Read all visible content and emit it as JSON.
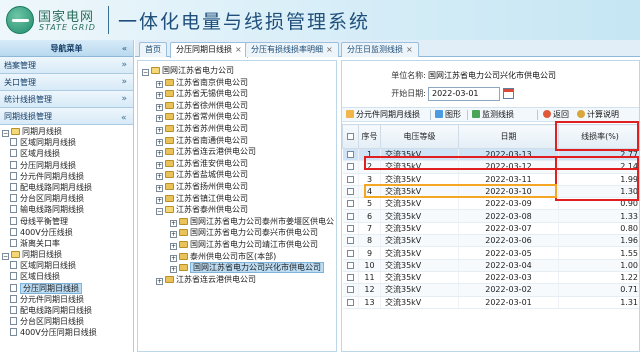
{
  "header": {
    "logo_cn": "国家电网",
    "logo_en": "STATE GRID",
    "app_title": "一体化电量与线损管理系统"
  },
  "sidebar": {
    "title": "导航菜单",
    "collapse_glyph": "«",
    "sections": [
      {
        "label": "档案管理",
        "chev": "»"
      },
      {
        "label": "关口管理",
        "chev": "»"
      },
      {
        "label": "统计线损管理",
        "chev": "»"
      },
      {
        "label": "同期线损管理",
        "chev": "»"
      }
    ],
    "tree": [
      {
        "label": "同期月线损",
        "type": "folder-open",
        "indent": 1
      },
      {
        "label": "区域同期月线损",
        "type": "file",
        "indent": 2
      },
      {
        "label": "区域月线损",
        "type": "file",
        "indent": 2
      },
      {
        "label": "分压同期月线损",
        "type": "file",
        "indent": 2
      },
      {
        "label": "分元件同期月线损",
        "type": "file",
        "indent": 2
      },
      {
        "label": "配电线路同期月线损",
        "type": "file",
        "indent": 2
      },
      {
        "label": "分台区同期月线损",
        "type": "file",
        "indent": 2
      },
      {
        "label": "输电线路同期线损",
        "type": "file",
        "indent": 2
      },
      {
        "label": "母线平衡管理",
        "type": "file",
        "indent": 2
      },
      {
        "label": "400V分压线损",
        "type": "file",
        "indent": 2
      },
      {
        "label": "渐离关口率",
        "type": "file",
        "indent": 2
      },
      {
        "label": "同期日线损",
        "type": "folder-open",
        "indent": 1
      },
      {
        "label": "区域同期日线损",
        "type": "file",
        "indent": 2
      },
      {
        "label": "区域日线损",
        "type": "file",
        "indent": 2
      },
      {
        "label": "分压同期日线损",
        "type": "file",
        "indent": 2,
        "selected": true
      },
      {
        "label": "分元件同期日线损",
        "type": "file",
        "indent": 2
      },
      {
        "label": "配电线路同期日线损",
        "type": "file",
        "indent": 2
      },
      {
        "label": "分台区同期日线损",
        "type": "file",
        "indent": 2
      },
      {
        "label": "400V分压同期日线损",
        "type": "file",
        "indent": 2
      }
    ]
  },
  "tabs": [
    {
      "label": "首页",
      "closable": false,
      "active": false
    },
    {
      "label": "分压同期日线损",
      "closable": true,
      "active": true
    },
    {
      "label": "分压有损线损率明细",
      "closable": true,
      "active": false
    },
    {
      "label": "分压日监测线损",
      "closable": true,
      "active": false
    }
  ],
  "org_tree": [
    {
      "label": "国网江苏省电力公司",
      "level": 0,
      "pm": "-",
      "open": true
    },
    {
      "label": "江苏省南京供电公司",
      "level": 1,
      "pm": "+"
    },
    {
      "label": "江苏省无锡供电公司",
      "level": 1,
      "pm": "+"
    },
    {
      "label": "江苏省徐州供电公司",
      "level": 1,
      "pm": "+"
    },
    {
      "label": "江苏省常州供电公司",
      "level": 1,
      "pm": "+"
    },
    {
      "label": "江苏省苏州供电公司",
      "level": 1,
      "pm": "+"
    },
    {
      "label": "江苏省南通供电公司",
      "level": 1,
      "pm": "+"
    },
    {
      "label": "江苏省连云港供电公司",
      "level": 1,
      "pm": "+"
    },
    {
      "label": "江苏省淮安供电公司",
      "level": 1,
      "pm": "+"
    },
    {
      "label": "江苏省盐城供电公司",
      "level": 1,
      "pm": "+"
    },
    {
      "label": "江苏省扬州供电公司",
      "level": 1,
      "pm": "+"
    },
    {
      "label": "江苏省镇江供电公司",
      "level": 1,
      "pm": "+"
    },
    {
      "label": "江苏省泰州供电公司",
      "level": 1,
      "pm": "-",
      "open": true
    },
    {
      "label": "国网江苏省电力公司泰州市姜堰区供电公",
      "level": 2,
      "pm": "+"
    },
    {
      "label": "国网江苏省电力公司泰兴市供电公司",
      "level": 2,
      "pm": "+"
    },
    {
      "label": "国网江苏省电力公司靖江市供电公司",
      "level": 2,
      "pm": "+"
    },
    {
      "label": "泰州供电公司市区(本部)",
      "level": 2,
      "pm": "+"
    },
    {
      "label": "国网江苏省电力公司兴化市供电公司",
      "level": 2,
      "pm": "+",
      "selected": true
    },
    {
      "label": "江苏省连云港供电公司",
      "level": 1,
      "pm": "+"
    }
  ],
  "form": {
    "org_label": "单位名称:",
    "org_value": "国网江苏省电力公司兴化市供电公司",
    "date_label": "开始日期:",
    "date_value": "2022-03-01"
  },
  "toolbar": {
    "btn1": "分元件同期月线损",
    "btn2": "图形",
    "btn3": "监测线损",
    "btn4": "返回",
    "btn5": "计算说明"
  },
  "table": {
    "headers": {
      "no": "序号",
      "level": "电压等级",
      "date": "日期",
      "rate": "线损率(%)"
    },
    "rows": [
      {
        "no": "1",
        "level": "交流35kV",
        "date": "2022-03-13",
        "rate": "2.77"
      },
      {
        "no": "2",
        "level": "交流35kV",
        "date": "2022-03-12",
        "rate": "2.14"
      },
      {
        "no": "3",
        "level": "交流35kV",
        "date": "2022-03-11",
        "rate": "1.99"
      },
      {
        "no": "4",
        "level": "交流35kV",
        "date": "2022-03-10",
        "rate": "1.30"
      },
      {
        "no": "5",
        "level": "交流35kV",
        "date": "2022-03-09",
        "rate": "0.90"
      },
      {
        "no": "6",
        "level": "交流35kV",
        "date": "2022-03-08",
        "rate": "1.33"
      },
      {
        "no": "7",
        "level": "交流35kV",
        "date": "2022-03-07",
        "rate": "0.80"
      },
      {
        "no": "8",
        "level": "交流35kV",
        "date": "2022-03-06",
        "rate": "1.96"
      },
      {
        "no": "9",
        "level": "交流35kV",
        "date": "2022-03-05",
        "rate": "1.55"
      },
      {
        "no": "10",
        "level": "交流35kV",
        "date": "2022-03-04",
        "rate": "1.00"
      },
      {
        "no": "11",
        "level": "交流35kV",
        "date": "2022-03-03",
        "rate": "1.22"
      },
      {
        "no": "12",
        "level": "交流35kV",
        "date": "2022-03-02",
        "rate": "0.71"
      },
      {
        "no": "13",
        "level": "交流35kV",
        "date": "2022-03-01",
        "rate": "1.31"
      }
    ]
  },
  "colors": {
    "highlight_red": "#e02020",
    "highlight_orange": "#f5a623",
    "selected_row": "#cfe5f7"
  }
}
